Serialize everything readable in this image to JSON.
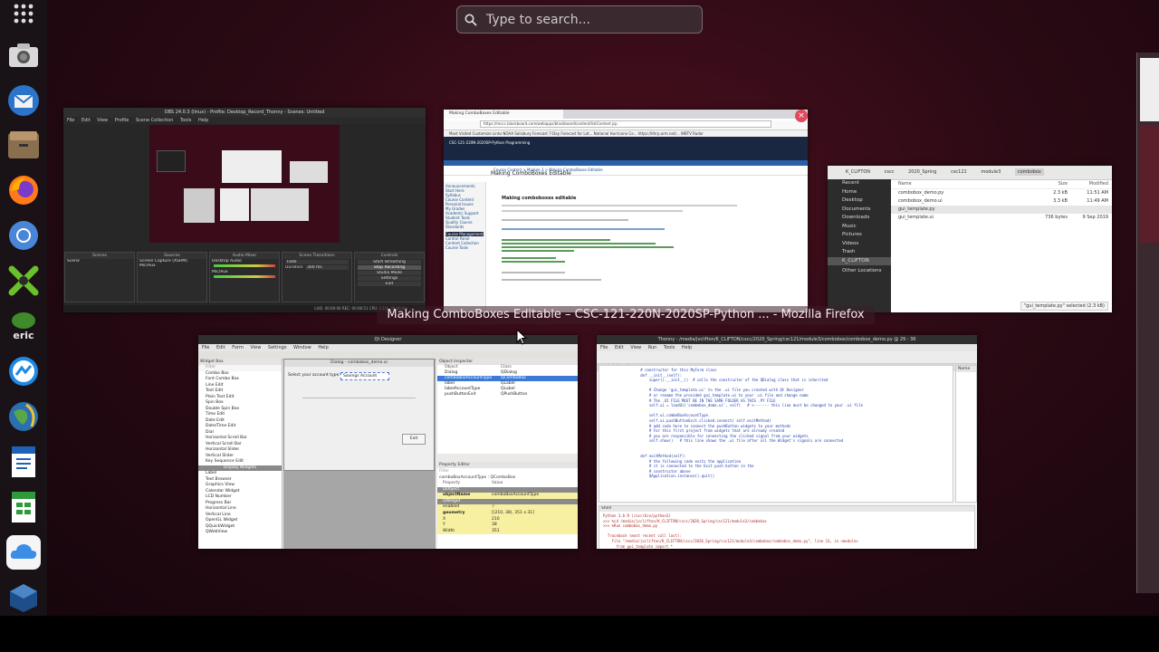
{
  "search": {
    "placeholder": "Type to search..."
  },
  "dock": {
    "items": [
      {
        "name": "show-applications"
      },
      {
        "name": "screenshot"
      },
      {
        "name": "thunderbird"
      },
      {
        "name": "files"
      },
      {
        "name": "firefox"
      },
      {
        "name": "chromium"
      },
      {
        "name": "crossover"
      },
      {
        "name": "eric"
      },
      {
        "name": "messenger"
      },
      {
        "name": "globe-browser"
      },
      {
        "name": "writer"
      },
      {
        "name": "calc"
      },
      {
        "name": "icloud"
      },
      {
        "name": "virtualbox"
      }
    ]
  },
  "window_label": "Making ComboBoxes Editable – CSC-121-220N-2020SP-Python ... - Mozilla Firefox",
  "obs": {
    "title": "OBS 24.0.3 (linux) - Profile: Desktop_Record_Thonny - Scenes: Untitled",
    "menu": [
      "File",
      "Edit",
      "View",
      "Profile",
      "Scene Collection",
      "Tools",
      "Help"
    ],
    "docks": [
      "Scenes",
      "Sources",
      "Audio Mixer",
      "Scene Transitions",
      "Controls"
    ],
    "scene": "Scene",
    "sources": [
      "Screen Capture (XSHM)",
      "Mic/Aux"
    ],
    "mixer": [
      "Desktop Audio",
      "Mic/Aux"
    ],
    "transition": "Fade",
    "duration_label": "Duration",
    "duration": "300 ms",
    "controls": [
      "Start Streaming",
      "Stop Recording",
      "Studio Mode",
      "Settings",
      "Exit"
    ],
    "status": "LIVE: 00:00:00   REC: 00:06:51   CPU: 3.1%, 30.00 fps"
  },
  "firefox": {
    "tab": "Making ComboBoxes Editable",
    "url": "https://mccc.blackboard.com/webapps/blackboard/content/listContent.jsp",
    "bookmarks": "Most Visited   Customize Links   NOAA Salisbury Forecast   7-Day Forecast for Lat...   National Hurricane Ce...   https://ithrp.arm.net/...   WBTV Radar",
    "course_header": "CSC-121-220N-2020SP-Python Programming",
    "breadcrumb": "Course Content  >  Module 3  >  Making ComboBoxes Editable",
    "page_heading": "Making ComboBoxes Editable",
    "item_title": "Making comboboxes editable",
    "side_links": [
      "Announcements",
      "Start Here",
      "Syllabus",
      "Course Content",
      "Personal Issues",
      "My Grades",
      "Academic Support",
      "Student Tools",
      "Quality Course Standards",
      "Course Management",
      "Control Panel",
      "Content Collection",
      "Course Tools"
    ]
  },
  "files": {
    "path": [
      "K_CLIFTON",
      "cscc",
      "2020_Spring",
      "csc121",
      "module3",
      "combobox"
    ],
    "sidebar": [
      "Recent",
      "Home",
      "Desktop",
      "Documents",
      "Downloads",
      "Music",
      "Pictures",
      "Videos",
      "Trash",
      "K_CLIFTON",
      "Other Locations"
    ],
    "columns": [
      "Name",
      "Size",
      "Modified"
    ],
    "rows": [
      {
        "name": "combobox_demo.py",
        "size": "2.3 kB",
        "modified": "11:51 AM"
      },
      {
        "name": "combobox_demo.ui",
        "size": "3.3 kB",
        "modified": "11:49 AM"
      },
      {
        "name": "gui_template.py",
        "size": "",
        "modified": ""
      },
      {
        "name": "gui_template.ui",
        "size": "736 bytes",
        "modified": "9 Sep 2019"
      }
    ],
    "status": "\"gui_template.py\" selected (2.3 kB)"
  },
  "qt": {
    "title": "Qt Designer",
    "menu": [
      "File",
      "Edit",
      "Form",
      "View",
      "Settings",
      "Window",
      "Help"
    ],
    "widget_box_header": "Widget Box",
    "filter": "Filter",
    "widgets": [
      "Combo Box",
      "Font Combo Box",
      "Line Edit",
      "Text Edit",
      "Plain Text Edit",
      "Spin Box",
      "Double Spin Box",
      "Time Edit",
      "Date Edit",
      "Date/Time Edit",
      "Dial",
      "Horizontal Scroll Bar",
      "Vertical Scroll Bar",
      "Horizontal Slider",
      "Vertical Slider",
      "Key Sequence Edit"
    ],
    "section": "Display Widgets",
    "display_widgets": [
      "Label",
      "Text Browser",
      "Graphics View",
      "Calendar Widget",
      "LCD Number",
      "Progress Bar",
      "Horizontal Line",
      "Vertical Line",
      "OpenGL Widget",
      "QQuickWidget",
      "QWebView"
    ],
    "form_title": "Dialog - combobox_demo.ui",
    "form_label": "Select your account type:",
    "form_combo": "Savings Account",
    "form_button": "Exit",
    "inspector_header": "Object Inspector",
    "inspector_cols": [
      "Object",
      "Class"
    ],
    "inspector_rows": [
      {
        "object": "Dialog",
        "class": "QDialog"
      },
      {
        "object": "comboBoxAccountType",
        "class": "QComboBox"
      },
      {
        "object": "label",
        "class": "QLabel"
      },
      {
        "object": "labelAccountType",
        "class": "QLabel"
      },
      {
        "object": "pushButtonExit",
        "class": "QPushButton"
      }
    ],
    "props_header": "Property Editor",
    "props_object": "comboBoxAccountType : QComboBox",
    "props_cols": [
      "Property",
      "Value"
    ],
    "props": [
      {
        "p": "QObject",
        "v": ""
      },
      {
        "p": "objectName",
        "v": "comboBoxAccountType"
      },
      {
        "p": "QWidget",
        "v": ""
      },
      {
        "p": "enabled",
        "v": "✓"
      },
      {
        "p": "geometry",
        "v": "[(210, 38), 351 x 31]"
      },
      {
        "p": "X",
        "v": "210"
      },
      {
        "p": "Y",
        "v": "38"
      },
      {
        "p": "Width",
        "v": "351"
      }
    ]
  },
  "thonny": {
    "title": "Thonny - /media/jvclifton/K_CLIFTON/cscc/2020_Spring/csc121/module3/combobox/combobox_demo.py @ 29 : 36",
    "menu": [
      "File",
      "Edit",
      "View",
      "Run",
      "Tools",
      "Help"
    ],
    "tab": "combobox_demo.py",
    "var_header": "Name",
    "code": "        # constructor for this MyForm class\n        def __init__(self):\n            super().__init__()  # calls the constructor of the QDialog class that is inherited\n\n            # Change 'gui_template.ui' to the .ui file you created with Qt Designer\n            # or rename the provided gui_template.ui to your .ui file and change name\n            # The .UI FILE MUST BE IN THE SAME FOLDER AS THIS .PY FILE\n            self.ui = loadUi('combobox_demo.ui', self)   # <------- this line must be changed to your .ui file\n\n            self.ui.comboBoxAccountType.\n            self.ui.pushButtonExit.clicked.connect( self.exitMethod)\n            # add code here to connect the pushButton widgets to your methods\n            # For this first project from widgets that are already created\n            # you are responsible for connecting the clicked signal from your widgets\n            self.show()   # this line shows the .ui file after all the Widget's signals are connected\n\n\n        def exitMethod(self):\n            # the following code exits the application\n            # it is connected to the Exit push button in the\n            # constructor above\n            QApplication.instance().quit()",
    "shell_header": "Shell",
    "shell": "Python 3.6.9 (/usr/bin/python3)\n>>> %cd /media/jvclifton/K_CLIFTON/cscc/2020_Spring/csc121/module3/combobox\n>>> %Run combobox_demo.py\n\n  Traceback (most recent call last):\n    File \"/media/jvclifton/K_CLIFTON/cscc/2020_Spring/csc121/module3/combobox/combobox_demo.py\", line 13, in <module>\n      from gui_template import *\n  ModuleNotFoundError: No module named 'gui_template'"
  },
  "colors": {
    "accent": "#e95420",
    "close": "#e04a5e",
    "selection": "#3a7ad6"
  }
}
